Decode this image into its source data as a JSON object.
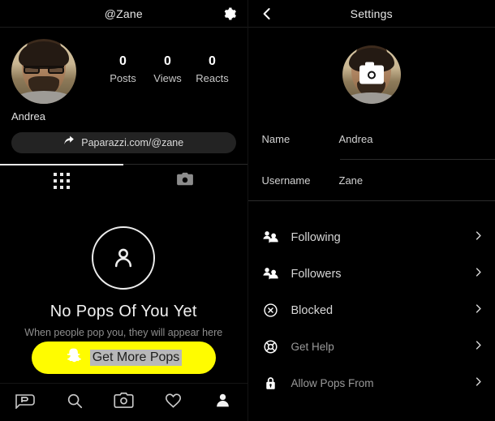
{
  "left": {
    "header": {
      "title": "@Zane",
      "gear_icon": "gear-icon"
    },
    "profile": {
      "display_name": "Andrea",
      "avatar_alt": "user-avatar",
      "stats": [
        {
          "value": "0",
          "label": "Posts"
        },
        {
          "value": "0",
          "label": "Views"
        },
        {
          "value": "0",
          "label": "Reacts"
        }
      ],
      "share": {
        "label": "Paparazzi.com/@zane",
        "icon": "share-arrow-icon"
      }
    },
    "tabs": [
      {
        "name": "grid",
        "icon": "grid-dots-icon",
        "active": true
      },
      {
        "name": "camera",
        "icon": "camera-icon",
        "active": false
      }
    ],
    "empty_state": {
      "icon": "person-circle-icon",
      "title": "No Pops Of You Yet",
      "subtitle": "When people pop you, they will appear here on your profile"
    },
    "cta": {
      "label": "Get More Pops",
      "icon": "snapchat-ghost-icon",
      "color": "#FFFC00"
    },
    "bottom_nav": [
      {
        "name": "pops-feed",
        "icon": "paparazzi-logo-icon",
        "active": false
      },
      {
        "name": "search",
        "icon": "search-icon",
        "active": false
      },
      {
        "name": "camera",
        "icon": "camera-icon",
        "active": false
      },
      {
        "name": "likes",
        "icon": "heart-icon",
        "active": false
      },
      {
        "name": "profile",
        "icon": "person-icon",
        "active": true
      }
    ]
  },
  "right": {
    "header": {
      "title": "Settings",
      "back_icon": "chevron-left-icon"
    },
    "avatar": {
      "alt": "settings-avatar",
      "badge_icon": "camera-icon"
    },
    "fields": [
      {
        "key": "Name",
        "value": "Andrea"
      },
      {
        "key": "Username",
        "value": "Zane"
      }
    ],
    "rows": [
      {
        "label": "Following",
        "icon": "people-icon",
        "chevron": "chevron-right-icon",
        "dim": false
      },
      {
        "label": "Followers",
        "icon": "people-icon",
        "chevron": "chevron-right-icon",
        "dim": false
      },
      {
        "label": "Blocked",
        "icon": "block-circle-x-icon",
        "chevron": "chevron-right-icon",
        "dim": false
      },
      {
        "label": "Get Help",
        "icon": "lifebuoy-icon",
        "chevron": "chevron-right-icon",
        "dim": true
      },
      {
        "label": "Allow Pops From",
        "icon": "lock-icon",
        "chevron": "chevron-right-icon",
        "dim": true
      }
    ]
  }
}
